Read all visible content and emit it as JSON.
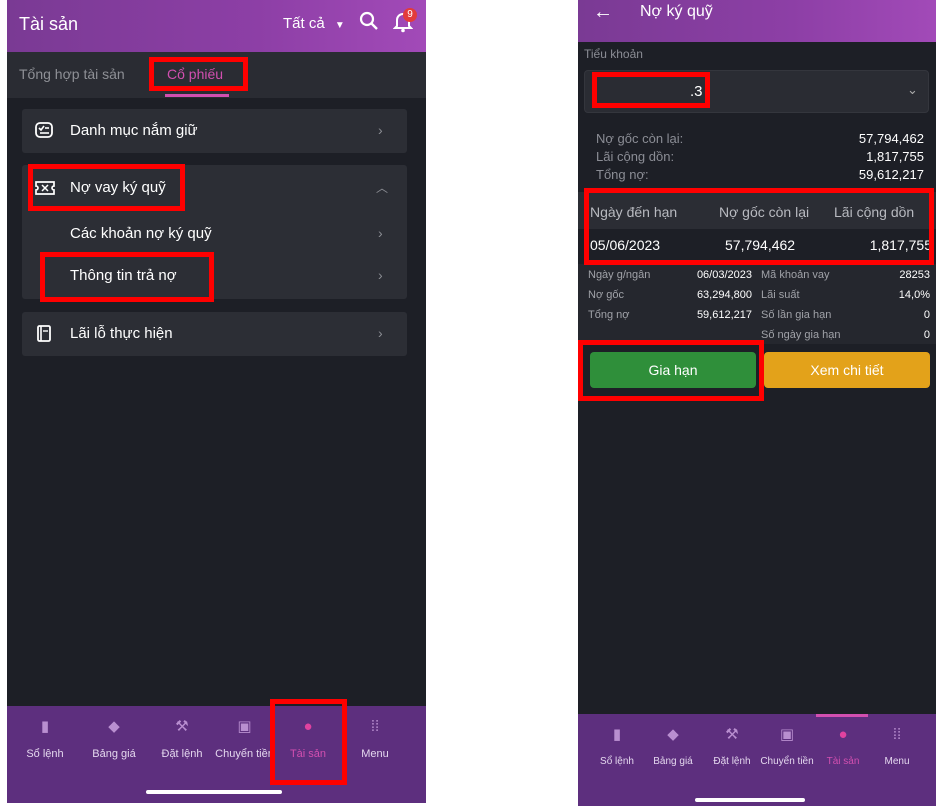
{
  "left": {
    "header": {
      "title": "Tài sản",
      "filter": "Tất cả",
      "notif_count": "9"
    },
    "tabs": [
      {
        "label": "Tổng hợp tài sản"
      },
      {
        "label": "Cổ phiếu"
      }
    ],
    "menu": {
      "portfolio": "Danh mục nắm giữ",
      "margin_debt": "Nợ vay ký quỹ",
      "margin_loans": "Các khoản nợ ký quỹ",
      "repayment_info": "Thông tin trả nợ",
      "realized_pnl": "Lãi lỗ thực hiện"
    }
  },
  "right": {
    "header": {
      "title": "Nợ ký quỹ"
    },
    "account": {
      "label": "Tiểu khoản",
      "value": ".3"
    },
    "summary": [
      {
        "label": "Nợ gốc còn lại:",
        "value": "57,794,462"
      },
      {
        "label": "Lãi cộng dồn:",
        "value": "1,817,755"
      },
      {
        "label": "Tổng nợ:",
        "value": "59,612,217"
      }
    ],
    "table": {
      "headers": [
        "Ngày đến hạn",
        "Nợ gốc còn lại",
        "Lãi cộng dồn"
      ],
      "row": [
        "05/06/2023",
        "57,794,462",
        "1,817,755"
      ]
    },
    "details": {
      "left": [
        {
          "label": "Ngày g/ngân",
          "value": "06/03/2023"
        },
        {
          "label": "Nợ gốc",
          "value": "63,294,800"
        },
        {
          "label": "Tổng nợ",
          "value": "59,612,217"
        }
      ],
      "right": [
        {
          "label": "Mã khoản vay",
          "value": "28253"
        },
        {
          "label": "Lãi suất",
          "value": "14,0%"
        },
        {
          "label": "Số lần gia hạn",
          "value": "0"
        },
        {
          "label": "Số ngày gia hạn",
          "value": "0"
        }
      ]
    },
    "buttons": {
      "extend": "Gia hạn",
      "view_detail": "Xem chi tiết"
    }
  },
  "nav": {
    "items": [
      {
        "label": "Sổ lệnh",
        "icon": "clipboard-icon"
      },
      {
        "label": "Bảng giá",
        "icon": "tag-icon"
      },
      {
        "label": "Đặt lệnh",
        "icon": "gavel-icon"
      },
      {
        "label": "Chuyển tiền",
        "icon": "wallet-icon"
      },
      {
        "label": "Tài sản",
        "icon": "assets-icon"
      },
      {
        "label": "Menu",
        "icon": "grid-icon"
      }
    ]
  },
  "colors": {
    "accent": "#d24fb0",
    "header": "#8d3fa6",
    "nav": "#5d2f7e",
    "green_button": "#2f8f3a",
    "orange_button": "#e3a21a",
    "highlight": "#ff0000"
  }
}
